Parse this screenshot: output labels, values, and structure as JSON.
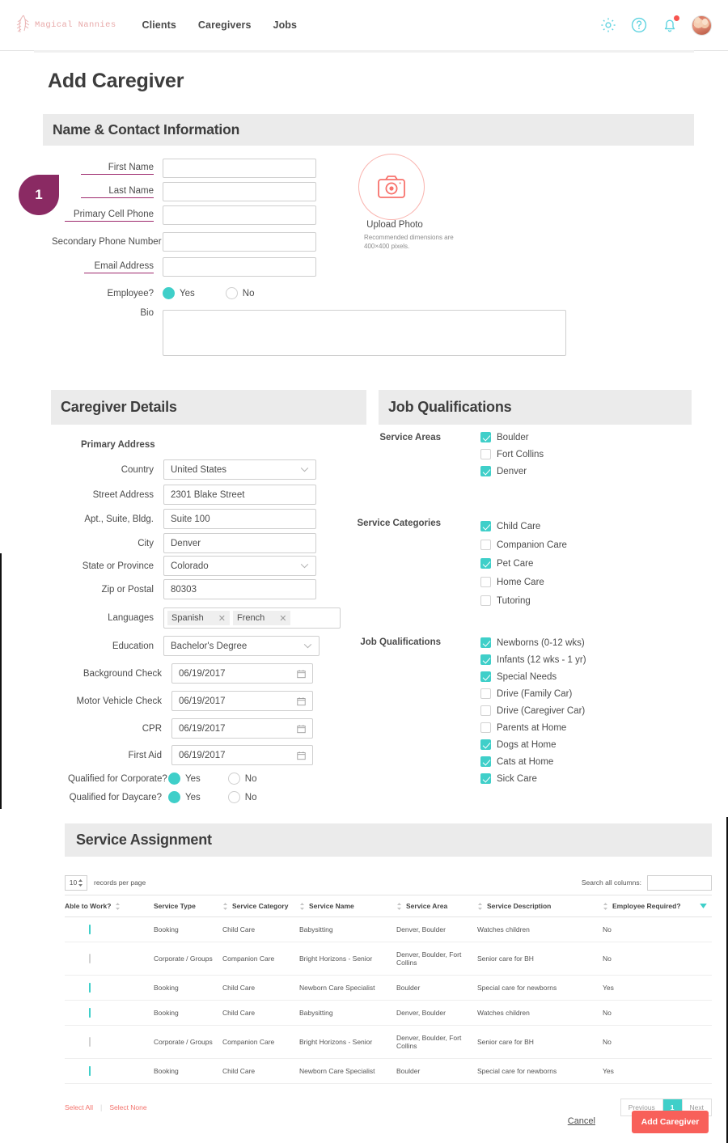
{
  "brand": {
    "name": "Magical Nannies"
  },
  "nav": {
    "items": [
      {
        "label": "Clients"
      },
      {
        "label": "Caregivers"
      },
      {
        "label": "Jobs"
      }
    ]
  },
  "topicons": {
    "settings": "gear-icon",
    "help": "question-circle-icon",
    "notifications": "bell-icon",
    "avatar": "user-avatar"
  },
  "page": {
    "title": "Add Caregiver",
    "step_badge": "1"
  },
  "sections": {
    "name_contact": "Name & Contact Information",
    "caregiver_details": "Caregiver Details",
    "job_qualifications": "Job Qualifications",
    "service_assignment": "Service Assignment"
  },
  "contact": {
    "first_name": {
      "label": "First Name",
      "value": "",
      "required": true
    },
    "last_name": {
      "label": "Last Name",
      "value": "",
      "required": true
    },
    "primary_cell": {
      "label": "Primary Cell Phone",
      "value": "",
      "required": true
    },
    "secondary": {
      "label": "Secondary Phone Number",
      "value": "",
      "required": false
    },
    "email": {
      "label": "Email Address",
      "value": "",
      "required": true
    },
    "employee": {
      "label": "Employee?",
      "yes": "Yes",
      "no": "No",
      "selected": "Yes"
    },
    "bio": {
      "label": "Bio",
      "value": ""
    }
  },
  "upload": {
    "label": "Upload Photo",
    "hint": "Recommended dimensions are 400×400 pixels.",
    "icon": "camera-icon"
  },
  "details": {
    "primary_address_label": "Primary Address",
    "country": {
      "label": "Country",
      "value": "United States"
    },
    "street": {
      "label": "Street Address",
      "value": "2301 Blake Street"
    },
    "apt": {
      "label": "Apt., Suite, Bldg.",
      "value": "Suite 100"
    },
    "city": {
      "label": "City",
      "value": "Denver"
    },
    "state": {
      "label": "State or Province",
      "value": "Colorado"
    },
    "zip": {
      "label": "Zip or Postal",
      "value": "80303"
    },
    "languages": {
      "label": "Languages",
      "tags": [
        "Spanish",
        "French"
      ]
    },
    "education": {
      "label": "Education",
      "value": "Bachelor's Degree"
    },
    "background_check": {
      "label": "Background Check",
      "value": "06/19/2017"
    },
    "motor_vehicle": {
      "label": "Motor Vehicle Check",
      "value": "06/19/2017"
    },
    "cpr": {
      "label": "CPR",
      "value": "06/19/2017"
    },
    "first_aid": {
      "label": "First Aid",
      "value": "06/19/2017"
    },
    "qualified_corporate": {
      "label": "Qualified for Corporate?",
      "yes": "Yes",
      "no": "No",
      "selected": "Yes"
    },
    "qualified_daycare": {
      "label": "Qualified for Daycare?",
      "yes": "Yes",
      "no": "No",
      "selected": "Yes"
    }
  },
  "qualifications": {
    "service_areas": {
      "label": "Service Areas",
      "items": [
        {
          "label": "Boulder",
          "checked": true
        },
        {
          "label": "Fort Collins",
          "checked": false
        },
        {
          "label": "Denver",
          "checked": true
        }
      ]
    },
    "service_categories": {
      "label": "Service Categories",
      "items": [
        {
          "label": "Child Care",
          "checked": true
        },
        {
          "label": "Companion Care",
          "checked": false
        },
        {
          "label": "Pet Care",
          "checked": true
        },
        {
          "label": "Home Care",
          "checked": false
        },
        {
          "label": "Tutoring",
          "checked": false
        }
      ]
    },
    "job_qualifications": {
      "label": "Job Qualifications",
      "items": [
        {
          "label": "Newborns (0-12 wks)",
          "checked": true
        },
        {
          "label": "Infants (12 wks - 1 yr)",
          "checked": true
        },
        {
          "label": "Special Needs",
          "checked": true
        },
        {
          "label": "Drive (Family Car)",
          "checked": false
        },
        {
          "label": "Drive (Caregiver Car)",
          "checked": false
        },
        {
          "label": "Parents at Home",
          "checked": false
        },
        {
          "label": "Dogs at Home",
          "checked": true
        },
        {
          "label": "Cats at Home",
          "checked": true
        },
        {
          "label": "Sick Care",
          "checked": true
        }
      ]
    }
  },
  "table": {
    "records_per_page_value": "10",
    "records_per_page_label": "records per page",
    "search_label": "Search all columns:",
    "search_value": "",
    "columns": [
      "Able to Work?",
      "Service Type",
      "Service Category",
      "Service Name",
      "Service Area",
      "Service Description",
      "Employee Required?"
    ],
    "rows": [
      {
        "checked": true,
        "service_type": "Booking",
        "service_category": "Child Care",
        "service_name": "Babysitting",
        "service_area": "Denver, Boulder",
        "service_description": "Watches children",
        "employee_required": "No"
      },
      {
        "checked": false,
        "service_type": "Corporate / Groups",
        "service_category": "Companion Care",
        "service_name": "Bright Horizons - Senior",
        "service_area": "Denver, Boulder, Fort Collins",
        "service_description": "Senior care for BH",
        "employee_required": "No"
      },
      {
        "checked": true,
        "service_type": "Booking",
        "service_category": "Child Care",
        "service_name": "Newborn Care Specialist",
        "service_area": "Boulder",
        "service_description": "Special care for newborns",
        "employee_required": "Yes"
      },
      {
        "checked": true,
        "service_type": "Booking",
        "service_category": "Child Care",
        "service_name": "Babysitting",
        "service_area": "Denver, Boulder",
        "service_description": "Watches children",
        "employee_required": "No"
      },
      {
        "checked": false,
        "service_type": "Corporate / Groups",
        "service_category": "Companion Care",
        "service_name": "Bright Horizons - Senior",
        "service_area": "Denver, Boulder, Fort Collins",
        "service_description": "Senior care for BH",
        "employee_required": "No"
      },
      {
        "checked": true,
        "service_type": "Booking",
        "service_category": "Child Care",
        "service_name": "Newborn Care Specialist",
        "service_area": "Boulder",
        "service_description": "Special care for newborns",
        "employee_required": "Yes"
      }
    ],
    "select_all": "Select All",
    "select_none": "Select None",
    "pager": {
      "previous": "Previous",
      "current": "1",
      "next": "Next"
    }
  },
  "actions": {
    "cancel": "Cancel",
    "submit": "Add Caregiver"
  },
  "colors": {
    "accent_teal": "#3fcfc9",
    "accent_red": "#f8605a",
    "badge_purple": "#8a2a63",
    "required_underline": "#9e2a6e",
    "band_gray": "#ebebeb",
    "logo_pink": "#e8a9a9"
  }
}
